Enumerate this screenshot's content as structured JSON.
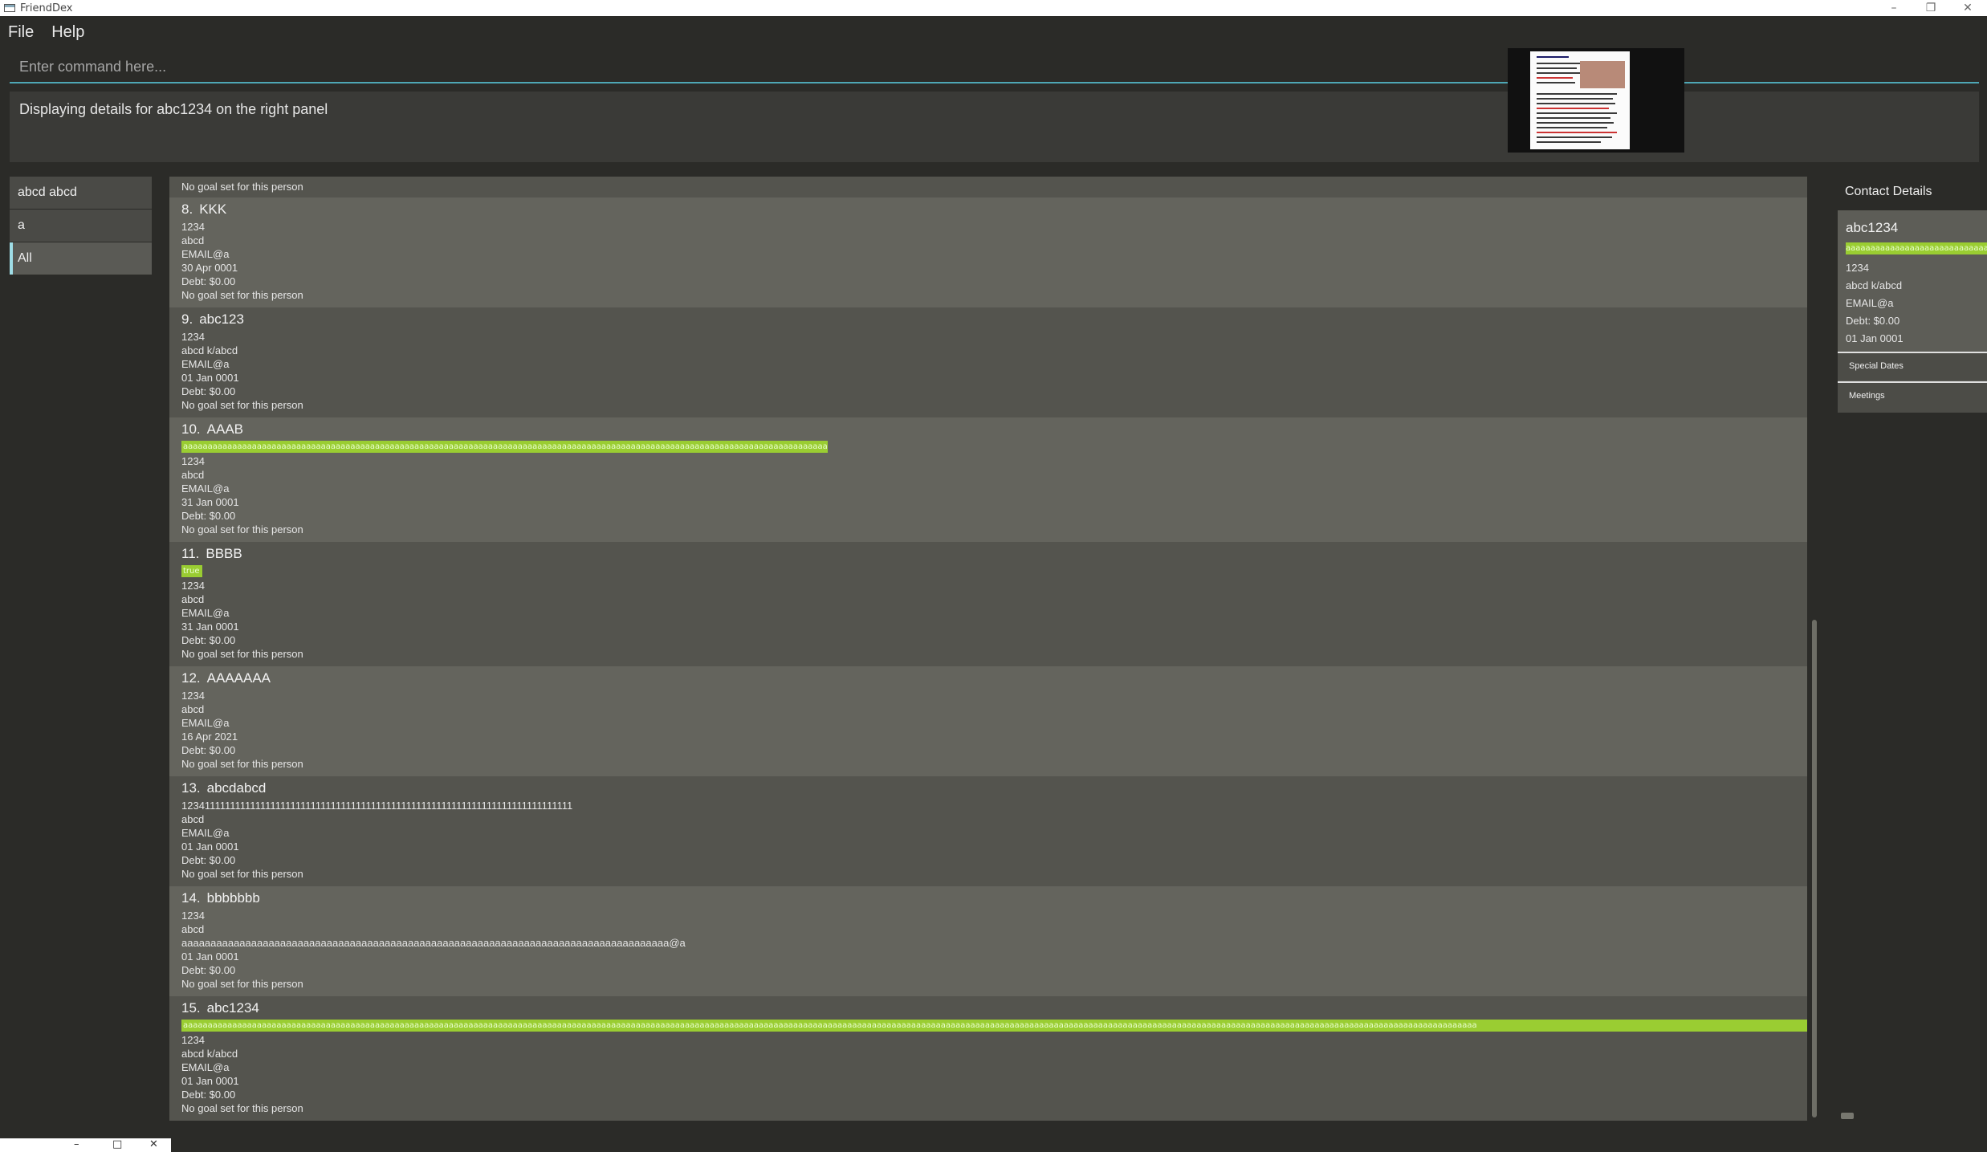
{
  "window": {
    "title": "FriendDex"
  },
  "menu": {
    "file": "File",
    "help": "Help"
  },
  "command": {
    "placeholder": "Enter command here..."
  },
  "result": {
    "text": "Displaying details for abc1234 on the right panel"
  },
  "tags": [
    {
      "label": "abcd abcd"
    },
    {
      "label": "a"
    },
    {
      "label": "All",
      "selected": true
    }
  ],
  "person_list": {
    "partial_top_goal": "No goal set for this person",
    "persons": [
      {
        "index": "8.",
        "name": "KKK",
        "phone": "1234",
        "address": "abcd",
        "email": "EMAIL@a",
        "date": "30 Apr 0001",
        "debt": "Debt: $0.00",
        "goal": "No goal set for this person"
      },
      {
        "index": "9.",
        "name": "abc123",
        "phone": "1234",
        "address": "abcd k/abcd",
        "email": "EMAIL@a",
        "date": "01 Jan 0001",
        "debt": "Debt: $0.00",
        "goal": "No goal set for this person"
      },
      {
        "index": "10.",
        "name": "AAAB",
        "tag": "aaaaaaaaaaaaaaaaaaaaaaaaaaaaaaaaaaaaaaaaaaaaaaaaaaaaaaaaaaaaaaaaaaaaaaaaaaaaaaaaaaaaaaaaaaaaaaaaaaaaaaaaaaaaaaaaaaaaaaaaaaaaaaaaaaaaaaaaaaaa",
        "phone": "1234",
        "address": "abcd",
        "email": "EMAIL@a",
        "date": "31 Jan 0001",
        "debt": "Debt: $0.00",
        "goal": "No goal set for this person"
      },
      {
        "index": "11.",
        "name": "BBBB",
        "tag": "true",
        "phone": "1234",
        "address": "abcd",
        "email": "EMAIL@a",
        "date": "31 Jan 0001",
        "debt": "Debt: $0.00",
        "goal": "No goal set for this person"
      },
      {
        "index": "12.",
        "name": "AAAAAAA",
        "phone": "1234",
        "address": "abcd",
        "email": "EMAIL@a",
        "date": "16 Apr 2021",
        "debt": "Debt: $0.00",
        "goal": "No goal set for this person"
      },
      {
        "index": "13.",
        "name": "abcdabcd",
        "phone": "12341111111111111111111111111111111111111111111111111111111111111111111111111",
        "address": "abcd",
        "email": "EMAIL@a",
        "date": "01 Jan 0001",
        "debt": "Debt: $0.00",
        "goal": "No goal set for this person"
      },
      {
        "index": "14.",
        "name": "bbbbbbb",
        "phone": "1234",
        "address": "abcd",
        "email": "aaaaaaaaaaaaaaaaaaaaaaaaaaaaaaaaaaaaaaaaaaaaaaaaaaaaaaaaaaaaaaaaaaaaaaaaaaaaaaaaaaaa@a",
        "date": "01 Jan 0001",
        "debt": "Debt: $0.00",
        "goal": "No goal set for this person"
      },
      {
        "index": "15.",
        "name": "abc1234",
        "tag": "aaaaaaaaaaaaaaaaaaaaaaaaaaaaaaaaaaaaaaaaaaaaaaaaaaaaaaaaaaaaaaaaaaaaaaaaaaaaaaaaaaaaaaaaaaaaaaaaaaaaaaaaaaaaaaaaaaaaaaaaaaaaaaaaaaaaaaaaaaaaaaaaaaaaaaaaaaaaaaaaaaaaaaaaaaaaaaaaaaaaaaaaaaaaaaaaaaaaaaaaaaaaaaaaaaaaaaaaaaaaaaaaaaaaaaaaaaaaaaaaaaaaaaaaaaaaaaaaaaaaaaa",
        "phone": "1234",
        "address": "abcd k/abcd",
        "email": "EMAIL@a",
        "date": "01 Jan 0001",
        "debt": "Debt: $0.00",
        "goal": "No goal set for this person"
      }
    ]
  },
  "details": {
    "title": "Contact Details",
    "name": "abc1234",
    "tag": "aaaaaaaaaaaaaaaaaaaaaaaaaaaaaaaaaaaaaaaaaaaaaaaaaaaa",
    "phone": "1234",
    "address": "abcd k/abcd",
    "email": "EMAIL@a",
    "debt": "Debt: $0.00",
    "date": "01 Jan 0001",
    "special_dates": "Special Dates",
    "meetings": "Meetings"
  },
  "colors": {
    "tag_green": "#9acd32",
    "command_accent": "#4ea7b5",
    "selected_tag_accent": "#9fdde6"
  }
}
